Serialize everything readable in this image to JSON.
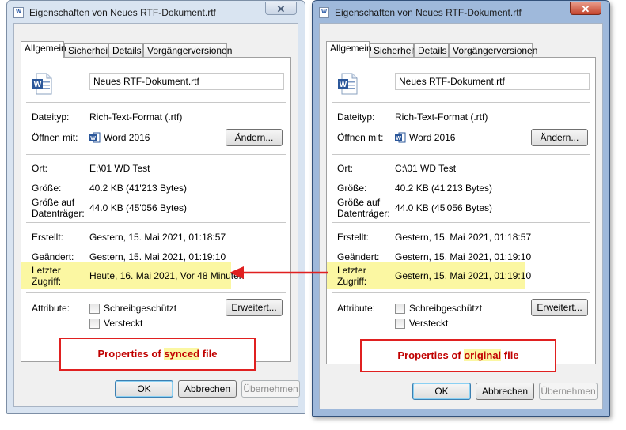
{
  "left_window": {
    "title": "Eigenschaften von Neues RTF-Dokument.rtf",
    "close_symbol": "✕",
    "tabs": [
      {
        "label": "Allgemein"
      },
      {
        "label": "Sicherheit"
      },
      {
        "label": "Details"
      },
      {
        "label": "Vorgängerversionen"
      }
    ],
    "file_name": "Neues RTF-Dokument.rtf",
    "labels": {
      "filetype": "Dateityp:",
      "open_with": "Öffnen mit:",
      "location": "Ort:",
      "size": "Größe:",
      "size_on_disk_1": "Größe auf",
      "size_on_disk_2": "Datenträger:",
      "created": "Erstellt:",
      "modified": "Geändert:",
      "accessed_1": "Letzter",
      "accessed_2": "Zugriff:",
      "attributes": "Attribute:"
    },
    "values": {
      "filetype": "Rich-Text-Format (.rtf)",
      "open_with": "Word 2016",
      "location": "E:\\01 WD Test",
      "size": "40.2 KB (41'213 Bytes)",
      "size_on_disk": "44.0 KB (45'056 Bytes)",
      "created": "Gestern, 15. Mai 2021, 01:18:57",
      "modified": "Gestern, 15. Mai 2021, 01:19:10",
      "accessed": "Heute, 16. Mai 2021, Vor 48 Minuten"
    },
    "buttons": {
      "change": "Ändern...",
      "advanced": "Erweitert...",
      "ok": "OK",
      "cancel": "Abbrechen",
      "apply": "Übernehmen"
    },
    "checkboxes": {
      "readonly": "Schreibgeschützt",
      "hidden": "Versteckt"
    },
    "annotation": {
      "prefix": "Properties of ",
      "highlight": "synced",
      "suffix": " file"
    }
  },
  "right_window": {
    "title": "Eigenschaften von Neues RTF-Dokument.rtf",
    "close_symbol": "✕",
    "tabs": [
      {
        "label": "Allgemein"
      },
      {
        "label": "Sicherheit"
      },
      {
        "label": "Details"
      },
      {
        "label": "Vorgängerversionen"
      }
    ],
    "file_name": "Neues RTF-Dokument.rtf",
    "labels": {
      "filetype": "Dateityp:",
      "open_with": "Öffnen mit:",
      "location": "Ort:",
      "size": "Größe:",
      "size_on_disk_1": "Größe auf",
      "size_on_disk_2": "Datenträger:",
      "created": "Erstellt:",
      "modified": "Geändert:",
      "accessed_1": "Letzter",
      "accessed_2": "Zugriff:",
      "attributes": "Attribute:"
    },
    "values": {
      "filetype": "Rich-Text-Format (.rtf)",
      "open_with": "Word 2016",
      "location": "C:\\01 WD Test",
      "size": "40.2 KB (41'213 Bytes)",
      "size_on_disk": "44.0 KB (45'056 Bytes)",
      "created": "Gestern, 15. Mai 2021, 01:18:57",
      "modified": "Gestern, 15. Mai 2021, 01:19:10",
      "accessed": "Gestern, 15. Mai 2021, 01:19:10"
    },
    "buttons": {
      "change": "Ändern...",
      "advanced": "Erweitert...",
      "ok": "OK",
      "cancel": "Abbrechen",
      "apply": "Übernehmen"
    },
    "checkboxes": {
      "readonly": "Schreibgeschützt",
      "hidden": "Versteckt"
    },
    "annotation": {
      "prefix": "Properties of ",
      "highlight": "original",
      "suffix": " file"
    }
  },
  "colors": {
    "highlight": "#fbf7a2",
    "annotation_red": "#e02020",
    "word_blue": "#2b579a"
  },
  "icons": {
    "file": "word-document-icon",
    "app": "word-app-icon",
    "arrow": "red-arrow-left"
  }
}
